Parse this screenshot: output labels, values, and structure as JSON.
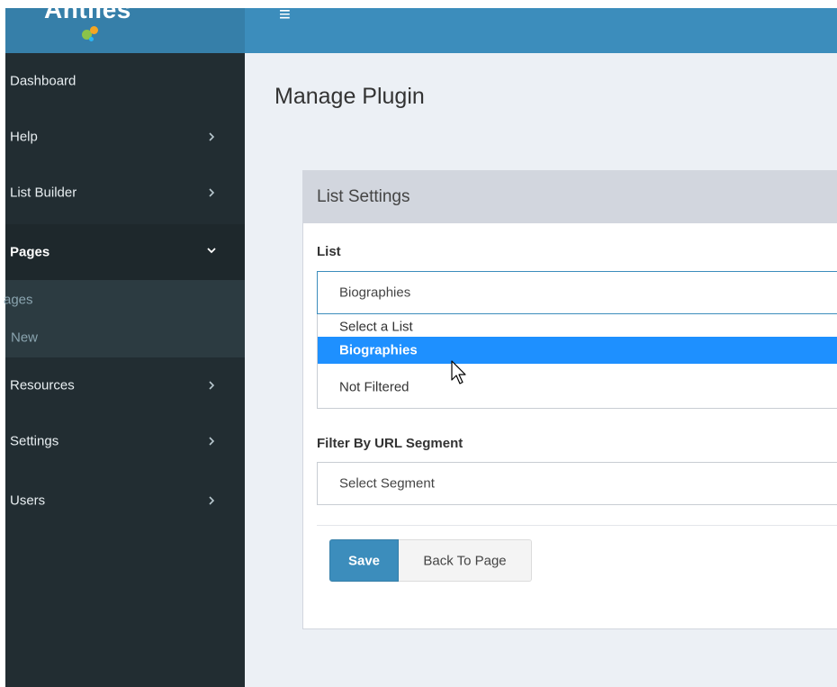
{
  "app": {
    "logo_text": "Antiles"
  },
  "colors": {
    "sidebar_bg": "#222d32",
    "topbar": "#3c8dbc",
    "primary_button": "#3c8dbc",
    "selected_option": "#1e90ff",
    "logo_dots": [
      "#8bc34a",
      "#f5a623",
      "#29b6f6"
    ]
  },
  "sidebar": {
    "items": [
      {
        "label": "Dashboard",
        "icon": "none"
      },
      {
        "label": "Help",
        "icon": "chevron-right-icon"
      },
      {
        "label": "List Builder",
        "icon": "chevron-right-icon"
      },
      {
        "label": "Pages",
        "icon": "chevron-down-icon",
        "expanded": true
      },
      {
        "label": "Resources",
        "icon": "chevron-right-icon"
      },
      {
        "label": "Settings",
        "icon": "chevron-right-icon"
      },
      {
        "label": "Users",
        "icon": "chevron-right-icon"
      }
    ],
    "submenu": [
      "ages",
      "New"
    ]
  },
  "header": {
    "hamburger": "≡"
  },
  "page": {
    "title": "Manage Plugin"
  },
  "box": {
    "title": "List Settings",
    "list_field": {
      "label": "List",
      "value": "Biographies",
      "options": [
        "Select a List",
        "Biographies",
        "Not Filtered"
      ],
      "highlighted": "Biographies"
    },
    "segment_field": {
      "label": "Filter By URL Segment",
      "value": "Select Segment"
    },
    "buttons": {
      "save": "Save",
      "back": "Back To Page"
    }
  }
}
